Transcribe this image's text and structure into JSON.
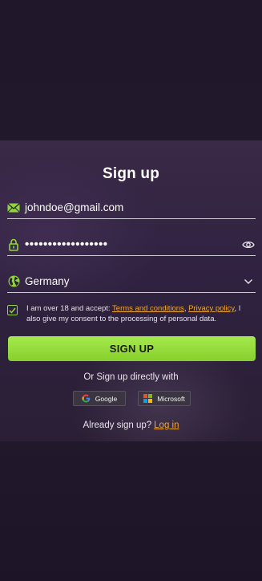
{
  "form": {
    "title": "Sign up",
    "email_value": "johndoe@gmail.com",
    "password_value": "••••••••••••••••••",
    "country_value": "Germany",
    "consent": {
      "checked": true,
      "prefix": "I am over 18 and accept: ",
      "terms_link": "Terms and conditions",
      "separator": ", ",
      "privacy_link": "Privacy policy",
      "suffix": ", I also give my consent to the processing of personal data."
    },
    "submit_label": "SIGN UP",
    "or_text": "Or Sign up directly with",
    "social": {
      "google_label": "Google",
      "microsoft_label": "Microsoft"
    },
    "already_text": "Already sign up?",
    "login_link": "Log in"
  },
  "colors": {
    "accent_green": "#8fd63b",
    "link_orange": "#f0a830",
    "background": "#1f1629"
  },
  "icons": {
    "email": "envelope-icon",
    "password": "lock-icon",
    "show_password": "eye-icon",
    "country": "globe-icon",
    "dropdown": "chevron-down-icon",
    "check": "checkmark-icon",
    "google": "google-logo-icon",
    "microsoft": "microsoft-logo-icon"
  }
}
